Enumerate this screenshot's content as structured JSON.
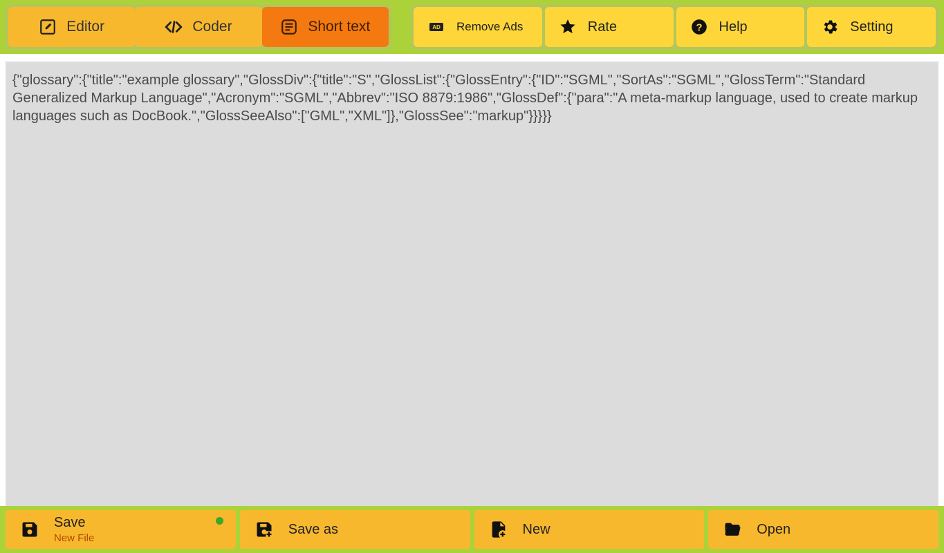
{
  "top": {
    "tabs": [
      {
        "label": "Editor",
        "active": false
      },
      {
        "label": "Coder",
        "active": false
      },
      {
        "label": "Short text",
        "active": true
      }
    ],
    "utils": [
      {
        "label": "Remove Ads"
      },
      {
        "label": "Rate"
      },
      {
        "label": "Help"
      },
      {
        "label": "Setting"
      }
    ]
  },
  "editor": {
    "text": "{\"glossary\":{\"title\":\"example glossary\",\"GlossDiv\":{\"title\":\"S\",\"GlossList\":{\"GlossEntry\":{\"ID\":\"SGML\",\"SortAs\":\"SGML\",\"GlossTerm\":\"Standard Generalized Markup Language\",\"Acronym\":\"SGML\",\"Abbrev\":\"ISO 8879:1986\",\"GlossDef\":{\"para\":\"A meta-markup language, used to create markup languages such as DocBook.\",\"GlossSeeAlso\":[\"GML\",\"XML\"]},\"GlossSee\":\"markup\"}}}}}"
  },
  "bottom": {
    "save": {
      "label": "Save",
      "sub": "New File"
    },
    "saveas": {
      "label": "Save as"
    },
    "newf": {
      "label": "New"
    },
    "open": {
      "label": "Open"
    }
  }
}
